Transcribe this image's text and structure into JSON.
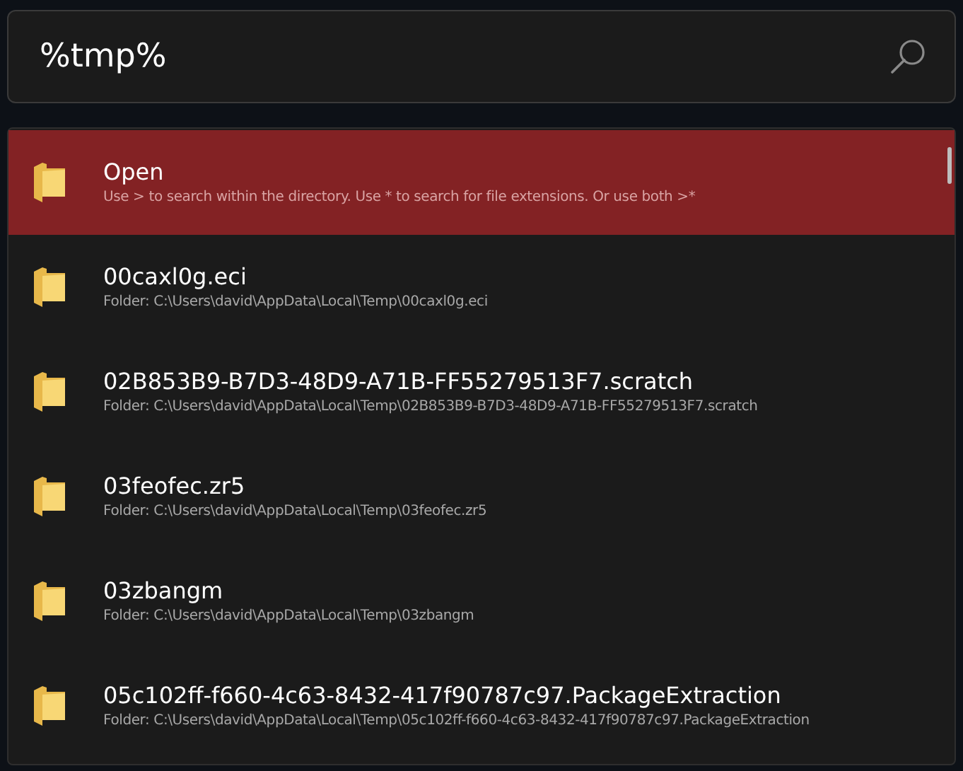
{
  "search": {
    "value": "%tmp%"
  },
  "results": [
    {
      "title": "Open",
      "subtitle": "Use > to search within the directory. Use * to search for file extensions. Or use both >*",
      "selected": true
    },
    {
      "title": "00caxl0g.eci",
      "subtitle": "Folder: C:\\Users\\david\\AppData\\Local\\Temp\\00caxl0g.eci",
      "selected": false
    },
    {
      "title": "02B853B9-B7D3-48D9-A71B-FF55279513F7.scratch",
      "subtitle": "Folder: C:\\Users\\david\\AppData\\Local\\Temp\\02B853B9-B7D3-48D9-A71B-FF55279513F7.scratch",
      "selected": false
    },
    {
      "title": "03feofec.zr5",
      "subtitle": "Folder: C:\\Users\\david\\AppData\\Local\\Temp\\03feofec.zr5",
      "selected": false
    },
    {
      "title": "03zbangm",
      "subtitle": "Folder: C:\\Users\\david\\AppData\\Local\\Temp\\03zbangm",
      "selected": false
    },
    {
      "title": "05c102ff-f660-4c63-8432-417f90787c97.PackageExtraction",
      "subtitle": "Folder: C:\\Users\\david\\AppData\\Local\\Temp\\05c102ff-f660-4c63-8432-417f90787c97.PackageExtraction",
      "selected": false
    }
  ]
}
